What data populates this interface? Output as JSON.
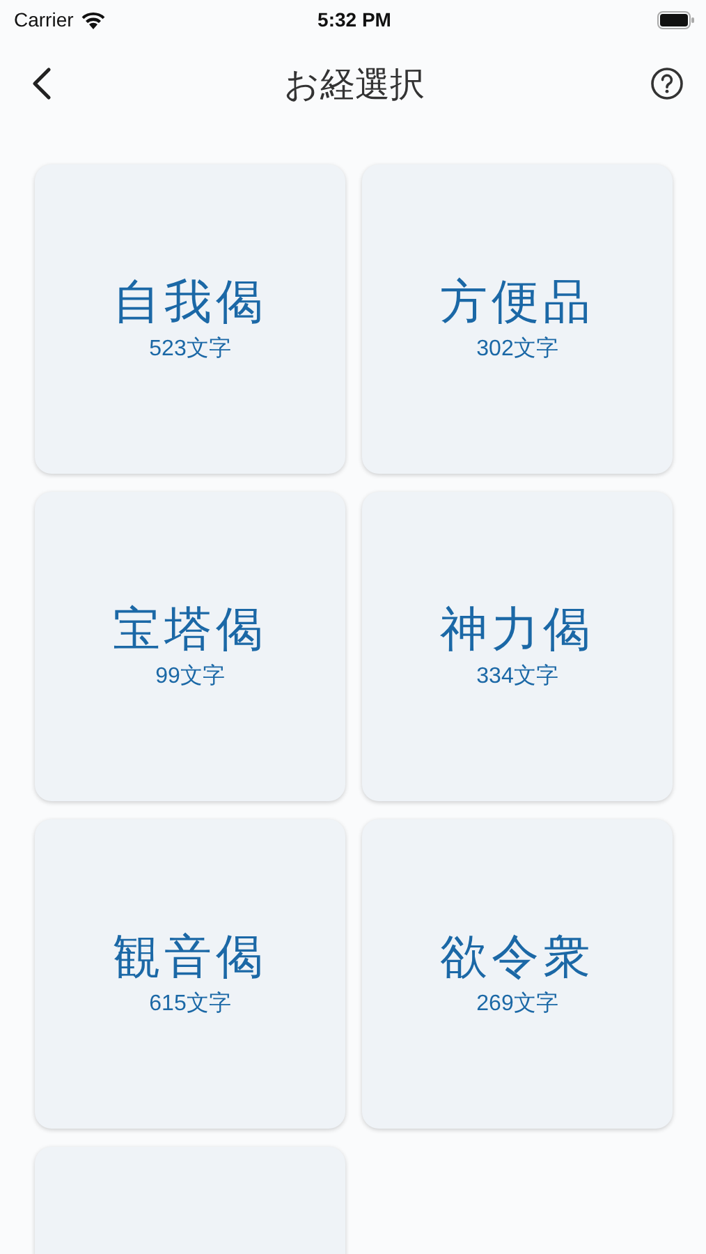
{
  "status_bar": {
    "carrier": "Carrier",
    "time": "5:32 PM"
  },
  "nav": {
    "title": "お経選択"
  },
  "cards": [
    {
      "kind": "sutra",
      "title": "自我偈",
      "count": "523文字"
    },
    {
      "kind": "sutra",
      "title": "方便品",
      "count": "302文字"
    },
    {
      "kind": "sutra",
      "title": "宝塔偈",
      "count": "99文字"
    },
    {
      "kind": "sutra",
      "title": "神力偈",
      "count": "334文字"
    },
    {
      "kind": "sutra",
      "title": "観音偈",
      "count": "615文字"
    },
    {
      "kind": "sutra",
      "title": "欲令衆",
      "count": "269文字"
    },
    {
      "kind": "blank"
    }
  ]
}
